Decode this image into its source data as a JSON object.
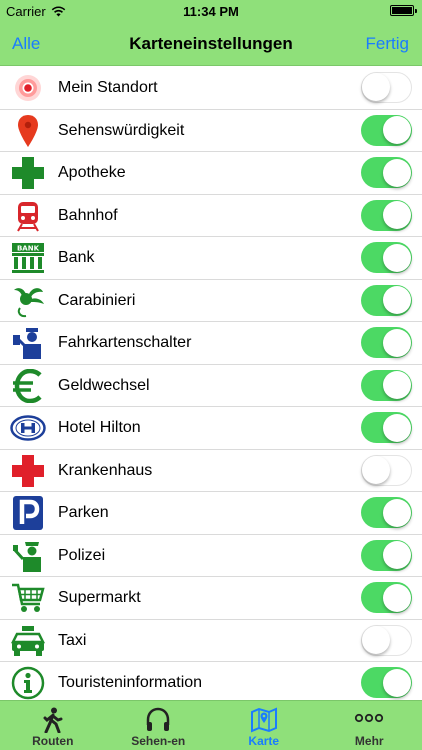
{
  "status": {
    "carrier": "Carrier",
    "time": "11:34 PM"
  },
  "nav": {
    "left": "Alle",
    "title": "Karteneinstellungen",
    "right": "Fertig"
  },
  "rows": [
    {
      "label": "Mein Standort",
      "icon": "location-dot-icon",
      "on": false
    },
    {
      "label": "Sehenswürdigkeit",
      "icon": "map-pin-icon",
      "on": true
    },
    {
      "label": "Apotheke",
      "icon": "pharmacy-cross-icon",
      "on": true
    },
    {
      "label": "Bahnhof",
      "icon": "train-icon",
      "on": true
    },
    {
      "label": "Bank",
      "icon": "bank-icon",
      "on": true
    },
    {
      "label": "Carabinieri",
      "icon": "carabinieri-icon",
      "on": true
    },
    {
      "label": "Fahrkartenschalter",
      "icon": "ticket-office-icon",
      "on": true
    },
    {
      "label": "Geldwechsel",
      "icon": "euro-icon",
      "on": true
    },
    {
      "label": "Hotel Hilton",
      "icon": "hilton-logo-icon",
      "on": true
    },
    {
      "label": "Krankenhaus",
      "icon": "hospital-cross-icon",
      "on": false
    },
    {
      "label": "Parken",
      "icon": "parking-icon",
      "on": true
    },
    {
      "label": "Polizei",
      "icon": "police-icon",
      "on": true
    },
    {
      "label": "Supermarkt",
      "icon": "shopping-cart-icon",
      "on": true
    },
    {
      "label": "Taxi",
      "icon": "taxi-icon",
      "on": false
    },
    {
      "label": "Touristeninformation",
      "icon": "info-icon",
      "on": true
    }
  ],
  "tabs": [
    {
      "label": "Routen",
      "icon": "walking-icon",
      "active": false
    },
    {
      "label": "Sehen-en",
      "icon": "headphones-icon",
      "active": false
    },
    {
      "label": "Karte",
      "icon": "map-icon",
      "active": true
    },
    {
      "label": "Mehr",
      "icon": "more-dots-icon",
      "active": false
    }
  ],
  "colors": {
    "bar": "#8fe07a",
    "accent": "#1a7cff",
    "toggle_on": "#4cd964",
    "icon_green": "#1e8a2a",
    "icon_red": "#e0202a",
    "icon_blue": "#1d3f9a"
  }
}
